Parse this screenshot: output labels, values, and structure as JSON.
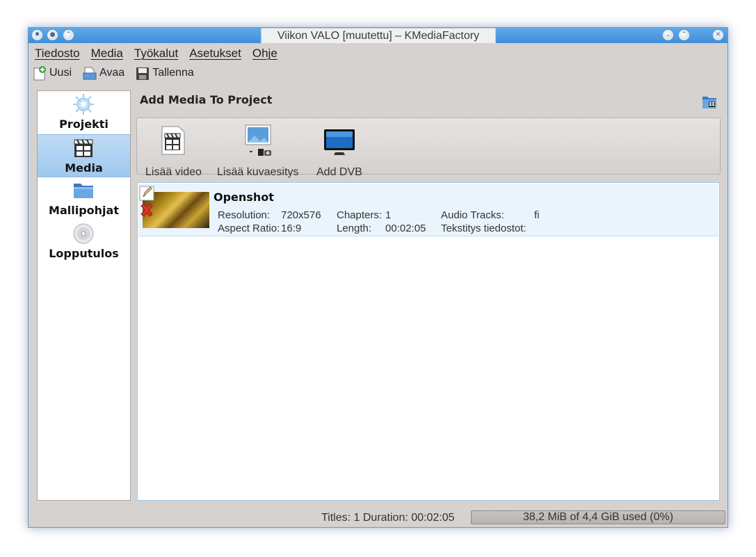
{
  "window": {
    "title": "Viikon VALO [muutettu] – KMediaFactory"
  },
  "titlebar_icons": {
    "app": "sun-icon",
    "minimize": "chevron-down-icon",
    "maximize": "chevron-up-icon",
    "close": "close-icon"
  },
  "menu": [
    "Tiedosto",
    "Media",
    "Työkalut",
    "Asetukset",
    "Ohje"
  ],
  "toolbar": {
    "new_label": "Uusi",
    "open_label": "Avaa",
    "save_label": "Tallenna"
  },
  "sidebar": {
    "items": [
      {
        "label": "Projekti",
        "icon": "gear-icon"
      },
      {
        "label": "Media",
        "icon": "clapperboard-icon",
        "active": true
      },
      {
        "label": "Mallipohjat",
        "icon": "folder-icon"
      },
      {
        "label": "Lopputulos",
        "icon": "disc-icon"
      }
    ]
  },
  "main": {
    "title": "Add Media To Project",
    "actions": [
      {
        "label": "Lisää video",
        "icon": "video-clapper-icon"
      },
      {
        "label": "Lisää kuvaesitys",
        "icon": "slideshow-icon"
      },
      {
        "label": "Add DVB",
        "icon": "tv-icon"
      }
    ]
  },
  "media_items": [
    {
      "name": "Openshot",
      "resolution_label": "Resolution:",
      "resolution": "720x576",
      "aspect_label": "Aspect Ratio:",
      "aspect": "16:9",
      "chapters_label": "Chapters:",
      "chapters": "1",
      "length_label": "Length:",
      "length": "00:02:05",
      "audio_label": "Audio Tracks:",
      "audio": "fi",
      "subtitles_label": "Tekstitys tiedostot:",
      "subtitles": ""
    }
  ],
  "status": {
    "titles_text": "Titles: 1 Duration: 00:02:05",
    "usage_text": "38,2 MiB of 4,4 GiB used (0%)",
    "usage_fraction": 0.0
  },
  "colors": {
    "accent": "#4a9ae0",
    "selection": "#9ec8ef",
    "window_bg": "#d6d2d0"
  }
}
